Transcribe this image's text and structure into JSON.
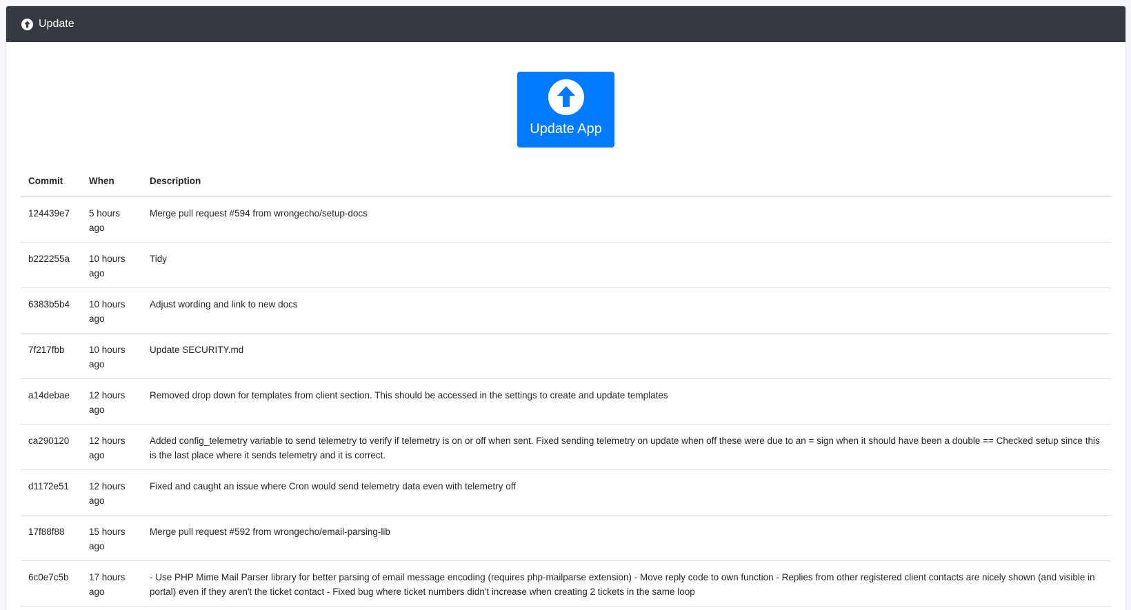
{
  "header": {
    "title": "Update",
    "icon": "arrow-circle-up-icon"
  },
  "update_button": {
    "label": "Update App",
    "icon": "arrow-circle-up-icon",
    "color": "#007bff"
  },
  "table": {
    "columns": [
      "Commit",
      "When",
      "Description"
    ],
    "rows": [
      {
        "commit": "124439e7",
        "when": "5 hours ago",
        "description": "Merge pull request #594 from wrongecho/setup-docs"
      },
      {
        "commit": "b222255a",
        "when": "10 hours ago",
        "description": "Tidy"
      },
      {
        "commit": "6383b5b4",
        "when": "10 hours ago",
        "description": "Adjust wording and link to new docs"
      },
      {
        "commit": "7f217fbb",
        "when": "10 hours ago",
        "description": "Update SECURITY.md"
      },
      {
        "commit": "a14debae",
        "when": "12 hours ago",
        "description": "Removed drop down for templates from client section. This should be accessed in the settings to create and update templates"
      },
      {
        "commit": "ca290120",
        "when": "12 hours ago",
        "description": "Added config_telemetry variable to send telemetry to verify if telemetry is on or off when sent. Fixed sending telemetry on update when off these were due to an = sign when it should have been a double == Checked setup since this is the last place where it sends telemetry and it is correct."
      },
      {
        "commit": "d1172e51",
        "when": "12 hours ago",
        "description": "Fixed and caught an issue where Cron would send telemetry data even with telemetry off"
      },
      {
        "commit": "17f88f88",
        "when": "15 hours ago",
        "description": "Merge pull request #592 from wrongecho/email-parsing-lib"
      },
      {
        "commit": "6c0e7c5b",
        "when": "17 hours ago",
        "description": "- Use PHP Mime Mail Parser library for better parsing of email message encoding (requires php-mailparse extension) - Move reply code to own function - Replies from other registered client contacts are nicely shown (and visible in portal) even if they aren't the ticket contact - Fixed bug where ticket numbers didn't increase when creating 2 tickets in the same loop"
      }
    ]
  }
}
